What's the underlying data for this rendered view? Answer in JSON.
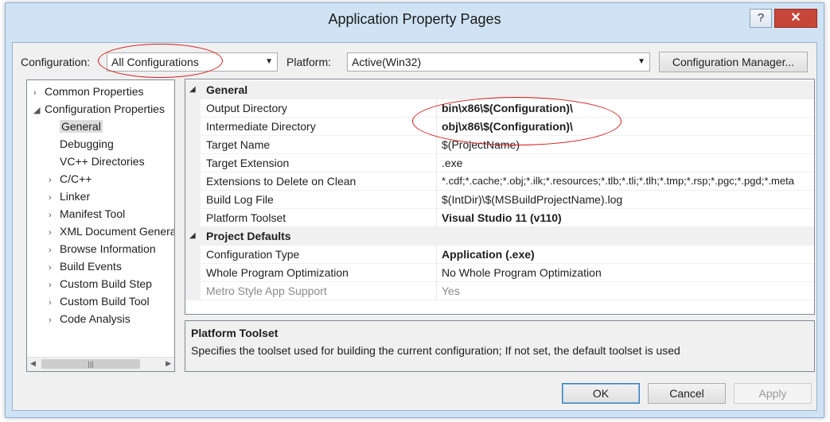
{
  "window": {
    "title": "Application Property Pages",
    "help_label": "?",
    "close_label": "✕"
  },
  "toolbar": {
    "configuration_label": "Configuration:",
    "configuration_value": "All Configurations",
    "platform_label": "Platform:",
    "platform_value": "Active(Win32)",
    "config_manager_label": "Configuration Manager..."
  },
  "tree": {
    "items": [
      {
        "label": "Common Properties",
        "expander": "›"
      },
      {
        "label": "Configuration Properties",
        "expander": "◢"
      },
      {
        "label": "General",
        "expander": ""
      },
      {
        "label": "Debugging",
        "expander": ""
      },
      {
        "label": "VC++ Directories",
        "expander": ""
      },
      {
        "label": "C/C++",
        "expander": "›"
      },
      {
        "label": "Linker",
        "expander": "›"
      },
      {
        "label": "Manifest Tool",
        "expander": "›"
      },
      {
        "label": "XML Document Generator",
        "expander": "›"
      },
      {
        "label": "Browse Information",
        "expander": "›"
      },
      {
        "label": "Build Events",
        "expander": "›"
      },
      {
        "label": "Custom Build Step",
        "expander": "›"
      },
      {
        "label": "Custom Build Tool",
        "expander": "›"
      },
      {
        "label": "Code Analysis",
        "expander": "›"
      }
    ],
    "scroll_left": "◀",
    "scroll_right": "▶",
    "scroll_grip": "|||"
  },
  "grid": {
    "categories": [
      {
        "label": "General",
        "toggle": "◢"
      },
      {
        "label": "Project Defaults",
        "toggle": "◢"
      }
    ],
    "rows": [
      {
        "name": "Output Directory",
        "value": "bin\\x86\\$(Configuration)\\"
      },
      {
        "name": "Intermediate Directory",
        "value": "obj\\x86\\$(Configuration)\\"
      },
      {
        "name": "Target Name",
        "value": "$(ProjectName)"
      },
      {
        "name": "Target Extension",
        "value": ".exe"
      },
      {
        "name": "Extensions to Delete on Clean",
        "value": "*.cdf;*.cache;*.obj;*.ilk;*.resources;*.tlb;*.tli;*.tlh;*.tmp;*.rsp;*.pgc;*.pgd;*.meta"
      },
      {
        "name": "Build Log File",
        "value": "$(IntDir)\\$(MSBuildProjectName).log"
      },
      {
        "name": "Platform Toolset",
        "value": "Visual Studio 11 (v110)"
      },
      {
        "name": "Configuration Type",
        "value": "Application (.exe)"
      },
      {
        "name": "Whole Program Optimization",
        "value": "No Whole Program Optimization"
      },
      {
        "name": "Metro Style App Support",
        "value": "Yes"
      }
    ]
  },
  "description": {
    "title": "Platform Toolset",
    "text": "Specifies the toolset used for building the current configuration; If not set, the default toolset is used"
  },
  "buttons": {
    "ok": "OK",
    "cancel": "Cancel",
    "apply": "Apply"
  },
  "colors": {
    "annotation": "#d41c1c",
    "window_frame": "#cfe3f4"
  }
}
